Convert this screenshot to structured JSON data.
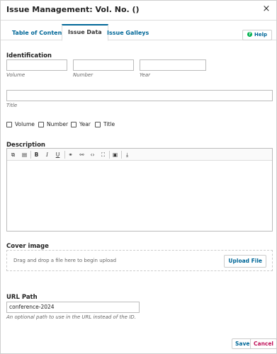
{
  "modal": {
    "title": "Issue Management: Vol. No. ()",
    "close_symbol": "×"
  },
  "tabs": [
    {
      "label": "Table of Contents",
      "active": false
    },
    {
      "label": "Issue Data",
      "active": true
    },
    {
      "label": "Issue Galleys",
      "active": false
    }
  ],
  "help": {
    "label": "Help",
    "icon": "?"
  },
  "identification": {
    "heading": "Identification",
    "volume": {
      "value": "",
      "label": "Volume"
    },
    "number": {
      "value": "",
      "label": "Number"
    },
    "year": {
      "value": "",
      "label": "Year"
    },
    "title": {
      "value": "",
      "label": "Title"
    }
  },
  "show_options": [
    {
      "label": "Volume",
      "checked": false
    },
    {
      "label": "Number",
      "checked": false
    },
    {
      "label": "Year",
      "checked": false
    },
    {
      "label": "Title",
      "checked": false
    }
  ],
  "description": {
    "heading": "Description",
    "toolbar_icons": [
      "copy-icon",
      "paste-icon",
      "bold-icon",
      "italic-icon",
      "underline-icon",
      "link-icon",
      "unlink-icon",
      "code-icon",
      "fullscreen-icon",
      "image-icon",
      "upload-icon"
    ],
    "toolbar_glyphs": [
      "⧉",
      "▤",
      "B",
      "I",
      "U",
      "⚭",
      "⚯",
      "‹›",
      "⛶",
      "▣",
      "⤓"
    ]
  },
  "cover_image": {
    "heading": "Cover image",
    "drop_text": "Drag and drop a file here to begin upload",
    "upload_label": "Upload File"
  },
  "url_path": {
    "heading": "URL Path",
    "value": "conference-2024",
    "help": "An optional path to use in the URL instead of the ID."
  },
  "actions": {
    "save": "Save",
    "cancel": "Cancel"
  },
  "colors": {
    "accent": "#006798",
    "cancel": "#c0135a",
    "help_dot": "#00b24e"
  }
}
